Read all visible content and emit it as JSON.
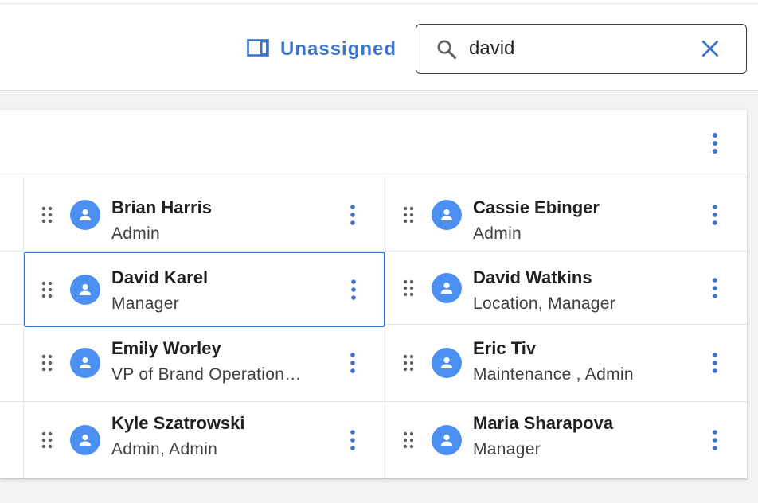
{
  "toolbar": {
    "unassigned_label": "Unassigned",
    "search_value": "david",
    "accent_color": "#3d74c9"
  },
  "people": [
    {
      "name": "Brian Harris",
      "role": "Admin"
    },
    {
      "name": "Cassie Ebinger",
      "role": "Admin"
    },
    {
      "name": "David Karel",
      "role": "Manager",
      "selected": true
    },
    {
      "name": "David Watkins",
      "role": "Location, Manager"
    },
    {
      "name": "Emily Worley",
      "role": "VP of Brand Operation…"
    },
    {
      "name": "Eric Tiv",
      "role": "Maintenance , Admin"
    },
    {
      "name": "Kyle Szatrowski",
      "role": "Admin, Admin"
    },
    {
      "name": "Maria Sharapova",
      "role": "Manager"
    }
  ]
}
